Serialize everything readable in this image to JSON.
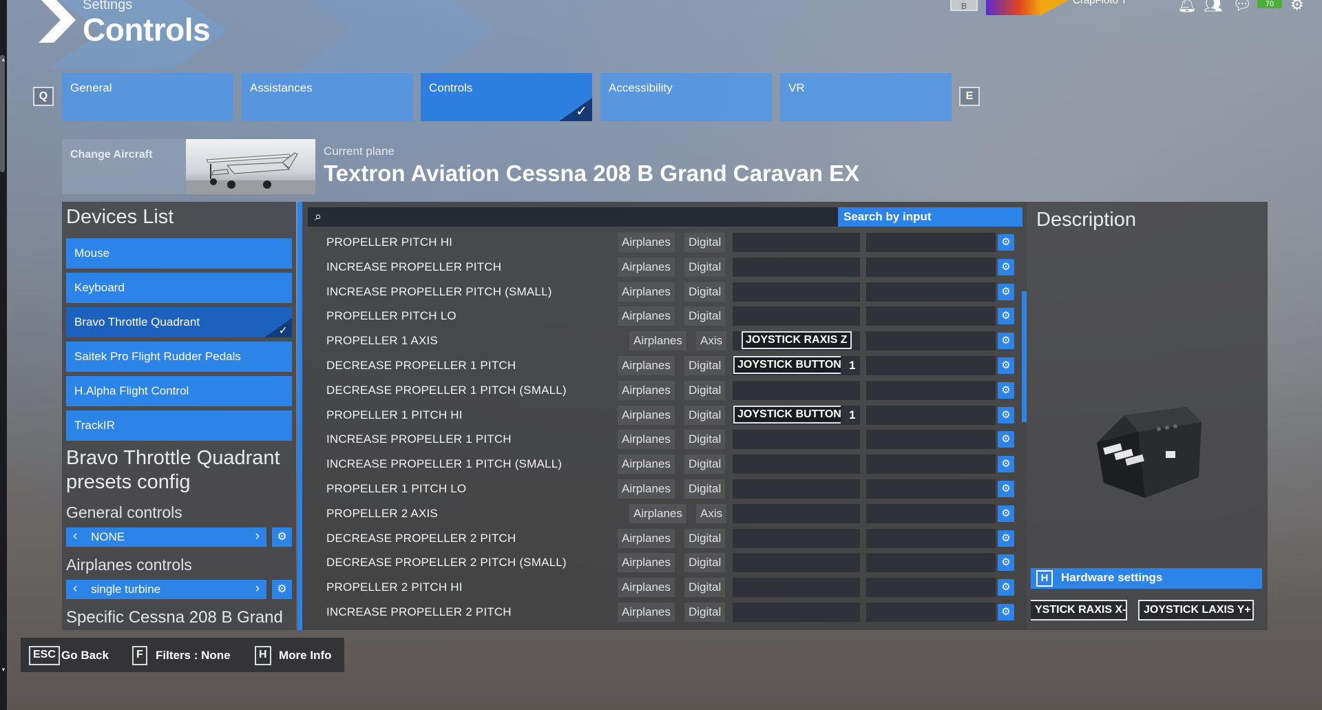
{
  "header": {
    "subtitle": "Settings",
    "title": "Controls",
    "user_name": "CrapFloto T",
    "top_key": "B",
    "notify_badge": "70"
  },
  "tabs": {
    "prev_key": "Q",
    "next_key": "E",
    "items": [
      {
        "label": "General",
        "active": false
      },
      {
        "label": "Assistances",
        "active": false
      },
      {
        "label": "Controls",
        "active": true
      },
      {
        "label": "Accessibility",
        "active": false
      },
      {
        "label": "VR",
        "active": false
      }
    ]
  },
  "aircraft": {
    "change_label": "Change Aircraft",
    "current_label": "Current plane",
    "current_name": "Textron Aviation Cessna 208 B Grand Caravan EX"
  },
  "devices": {
    "title": "Devices List",
    "items": [
      {
        "label": "Mouse"
      },
      {
        "label": "Keyboard"
      },
      {
        "label": "Bravo Throttle Quadrant"
      },
      {
        "label": "Saitek Pro Flight Rudder Pedals"
      },
      {
        "label": "H.Alpha Flight Control"
      },
      {
        "label": "TrackIR"
      }
    ],
    "presets_title": "Bravo Throttle Quadrant presets config",
    "general_label": "General controls",
    "general_value": "NONE",
    "airplanes_label": "Airplanes controls",
    "airplanes_value": "single turbine",
    "specific_label": "Specific Cessna 208 B Grand"
  },
  "list": {
    "search_by_input": "Search by input",
    "rows": [
      {
        "name": "PROPELLER PITCH HI",
        "category": "Airplanes",
        "type": "Digital",
        "binding1": "",
        "binding1_num": "",
        "binding2": ""
      },
      {
        "name": "INCREASE PROPELLER PITCH",
        "category": "Airplanes",
        "type": "Digital",
        "binding1": "",
        "binding1_num": "",
        "binding2": ""
      },
      {
        "name": "INCREASE PROPELLER PITCH (SMALL)",
        "category": "Airplanes",
        "type": "Digital",
        "binding1": "",
        "binding1_num": "",
        "binding2": ""
      },
      {
        "name": "PROPELLER PITCH LO",
        "category": "Airplanes",
        "type": "Digital",
        "binding1": "",
        "binding1_num": "",
        "binding2": ""
      },
      {
        "name": "PROPELLER 1 AXIS",
        "category": "Airplanes",
        "type": "Axis",
        "binding1": "JOYSTICK RAXIS Z",
        "binding1_num": "",
        "binding2": ""
      },
      {
        "name": "DECREASE PROPELLER 1 PITCH",
        "category": "Airplanes",
        "type": "Digital",
        "binding1": "JOYSTICK BUTTON",
        "binding1_num": "1",
        "binding2": ""
      },
      {
        "name": "DECREASE PROPELLER 1 PITCH (SMALL)",
        "category": "Airplanes",
        "type": "Digital",
        "binding1": "",
        "binding1_num": "",
        "binding2": ""
      },
      {
        "name": "PROPELLER 1 PITCH HI",
        "category": "Airplanes",
        "type": "Digital",
        "binding1": "JOYSTICK BUTTON",
        "binding1_num": "1",
        "binding2": ""
      },
      {
        "name": "INCREASE PROPELLER 1 PITCH",
        "category": "Airplanes",
        "type": "Digital",
        "binding1": "",
        "binding1_num": "",
        "binding2": ""
      },
      {
        "name": "INCREASE PROPELLER 1 PITCH (SMALL)",
        "category": "Airplanes",
        "type": "Digital",
        "binding1": "",
        "binding1_num": "",
        "binding2": ""
      },
      {
        "name": "PROPELLER 1 PITCH LO",
        "category": "Airplanes",
        "type": "Digital",
        "binding1": "",
        "binding1_num": "",
        "binding2": ""
      },
      {
        "name": "PROPELLER 2 AXIS",
        "category": "Airplanes",
        "type": "Axis",
        "binding1": "",
        "binding1_num": "",
        "binding2": ""
      },
      {
        "name": "DECREASE PROPELLER 2 PITCH",
        "category": "Airplanes",
        "type": "Digital",
        "binding1": "",
        "binding1_num": "",
        "binding2": ""
      },
      {
        "name": "DECREASE PROPELLER 2 PITCH (SMALL)",
        "category": "Airplanes",
        "type": "Digital",
        "binding1": "",
        "binding1_num": "",
        "binding2": ""
      },
      {
        "name": "PROPELLER 2 PITCH HI",
        "category": "Airplanes",
        "type": "Digital",
        "binding1": "",
        "binding1_num": "",
        "binding2": ""
      },
      {
        "name": "INCREASE PROPELLER 2 PITCH",
        "category": "Airplanes",
        "type": "Digital",
        "binding1": "",
        "binding1_num": "",
        "binding2": ""
      }
    ]
  },
  "description": {
    "title": "Description",
    "hardware_key": "H",
    "hardware_label": "Hardware settings",
    "axis_tags": [
      "YSTICK RAXIS X-",
      "JOYSTICK LAXIS Y+"
    ]
  },
  "footer": {
    "back_key": "ESC",
    "back_label": "Go Back",
    "filters_key": "F",
    "filters_label": "Filters : None",
    "info_key": "H",
    "info_label": "More Info"
  },
  "colors": {
    "accent": "#2c84e8",
    "accent_dark": "#1c61bd",
    "panel": "#464648"
  }
}
